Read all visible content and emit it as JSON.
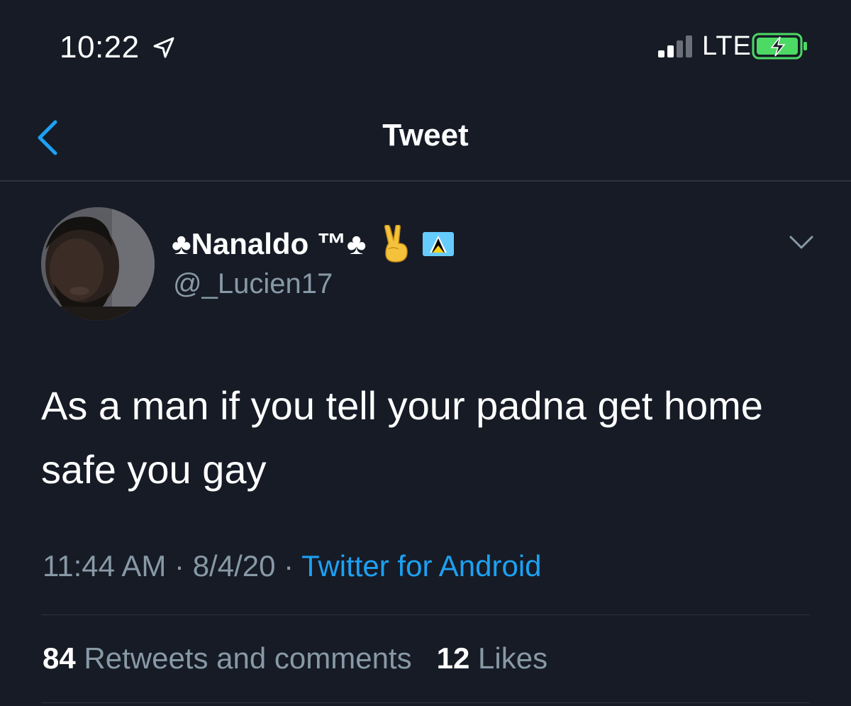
{
  "status_bar": {
    "time": "10:22",
    "network": "LTE",
    "location_icon": "location-arrow-icon",
    "signal_icon": "signal-bars-icon",
    "battery_icon": "battery-charging-icon"
  },
  "nav": {
    "back_icon": "chevron-left-icon",
    "title": "Tweet"
  },
  "tweet": {
    "display_name": "♣Nanaldo ™♣",
    "name_emojis": [
      "victory-hand-icon",
      "saint-lucia-flag-icon"
    ],
    "handle": "@_Lucien17",
    "text": "As a man if you tell your padna get home safe you gay",
    "time": "11:44 AM",
    "separator": "·",
    "date": "8/4/20",
    "source": "Twitter for Android"
  },
  "stats": {
    "retweets_count": "84",
    "retweets_label": "Retweets and comments",
    "likes_count": "12",
    "likes_label": "Likes"
  },
  "colors": {
    "background": "#161b26",
    "accent": "#1da1f2",
    "secondary_text": "#8899a6",
    "divider": "#2c3440",
    "battery": "#4cd964"
  }
}
